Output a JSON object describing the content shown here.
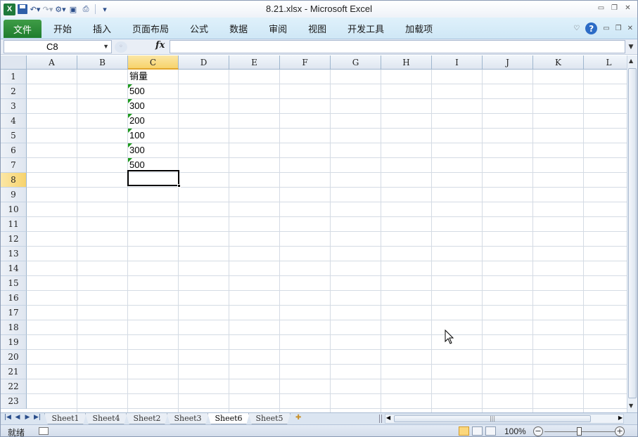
{
  "window": {
    "title": "8.21.xlsx  -  Microsoft Excel"
  },
  "ribbon": {
    "file_tab": "文件",
    "tabs": [
      "开始",
      "插入",
      "页面布局",
      "公式",
      "数据",
      "审阅",
      "视图",
      "开发工具",
      "加载项"
    ]
  },
  "formula_bar": {
    "name_box": "C8",
    "fx": "fx",
    "formula": ""
  },
  "grid": {
    "columns": [
      "A",
      "B",
      "C",
      "D",
      "E",
      "F",
      "G",
      "H",
      "I",
      "J",
      "K",
      "L"
    ],
    "rows": [
      "1",
      "2",
      "3",
      "4",
      "5",
      "6",
      "7",
      "8",
      "9",
      "10",
      "11",
      "12",
      "13",
      "14",
      "15",
      "16",
      "17",
      "18",
      "19",
      "20",
      "21",
      "22",
      "23"
    ],
    "selected_column": "C",
    "selected_row": "8",
    "cells": [
      {
        "ref": "C1",
        "value": "销量"
      },
      {
        "ref": "C2",
        "value": "500"
      },
      {
        "ref": "C3",
        "value": "300"
      },
      {
        "ref": "C4",
        "value": "200"
      },
      {
        "ref": "C5",
        "value": "100"
      },
      {
        "ref": "C6",
        "value": "300"
      },
      {
        "ref": "C7",
        "value": "500"
      }
    ]
  },
  "sheets": {
    "tabs": [
      "Sheet1",
      "Sheet4",
      "Sheet2",
      "Sheet3",
      "Sheet6",
      "Sheet5"
    ],
    "active": "Sheet6"
  },
  "status": {
    "mode": "就绪",
    "zoom": "100%"
  },
  "colors": {
    "file_tab": "#1e7d2d",
    "selected_header": "#f7d36c",
    "ribbon_bg": "#dff1fb"
  }
}
